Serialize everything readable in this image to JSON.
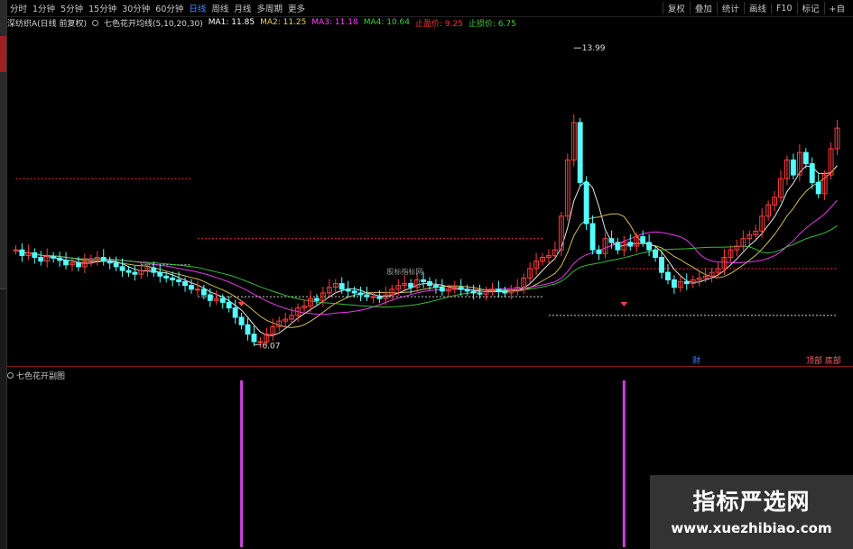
{
  "timeframes": [
    "分时",
    "1分钟",
    "5分钟",
    "15分钟",
    "30分钟",
    "60分钟",
    "日线",
    "周线",
    "月线",
    "多周期",
    "更多"
  ],
  "active_timeframe": "日线",
  "toolbar": [
    "复权",
    "叠加",
    "统计",
    "画线",
    "F10",
    "标记",
    "+自"
  ],
  "title": {
    "stock": "深纺织A(日线 前复权)",
    "indicator": "七色花开均线(5,10,20,30)",
    "ma1": "MA1: 11.85",
    "ma2": "MA2: 11.25",
    "ma3": "MA3: 11.18",
    "ma4": "MA4: 10.64",
    "stop_profit": "止盈价: 9.25",
    "stop_loss": "止损价: 6.75"
  },
  "annotations": {
    "high": "13.99",
    "low": "6.07",
    "center_watermark": "股标指标网",
    "cai_label": "财",
    "tags": "顶部 底部"
  },
  "sub_indicator": "七色花开副图",
  "watermark": {
    "cn": "指标严选网",
    "url": "www.xuezhibiao.com"
  },
  "colors": {
    "up": "#ff3c3c",
    "down": "#54ffff",
    "ma1": "#ffffff",
    "ma2": "#e8d060",
    "ma3": "#ff40ff",
    "ma4": "#40d040",
    "signal": "#d040e0",
    "stop_profit": "#ff3030",
    "stop_loss": "#d0d0d0"
  },
  "chart_data": {
    "type": "candlestick",
    "ylim": [
      5.5,
      14.5
    ],
    "closes": [
      8.6,
      8.45,
      8.52,
      8.4,
      8.3,
      8.42,
      8.38,
      8.32,
      8.2,
      8.25,
      8.15,
      8.28,
      8.35,
      8.4,
      8.3,
      8.25,
      8.15,
      8.05,
      8.0,
      7.95,
      8.05,
      8.12,
      8.0,
      7.9,
      7.85,
      7.8,
      7.75,
      7.65,
      7.55,
      7.55,
      7.4,
      7.25,
      7.3,
      7.2,
      7.05,
      6.8,
      6.6,
      6.35,
      6.15,
      6.15,
      6.35,
      6.55,
      6.7,
      6.75,
      6.85,
      7.05,
      7.1,
      7.3,
      7.25,
      7.45,
      7.6,
      7.7,
      7.55,
      7.5,
      7.45,
      7.4,
      7.35,
      7.35,
      7.3,
      7.4,
      7.55,
      7.65,
      7.7,
      7.6,
      7.8,
      7.75,
      7.65,
      7.6,
      7.5,
      7.55,
      7.6,
      7.55,
      7.5,
      7.45,
      7.42,
      7.5,
      7.55,
      7.5,
      7.45,
      7.5,
      7.6,
      7.85,
      8.1,
      8.3,
      8.4,
      8.45,
      8.6,
      9.5,
      11.0,
      12.0,
      10.4,
      9.3,
      8.6,
      8.5,
      8.9,
      8.8,
      8.6,
      8.8,
      8.7,
      8.95,
      8.8,
      8.6,
      8.4,
      8.0,
      7.8,
      7.6,
      7.75,
      7.7,
      7.8,
      7.85,
      7.9,
      8.0,
      8.1,
      8.4,
      8.6,
      8.7,
      8.9,
      9.0,
      9.1,
      9.5,
      9.8,
      10.0,
      10.5,
      11.0,
      10.6,
      11.2,
      10.9,
      10.4,
      10.1,
      10.6,
      11.3,
      11.85
    ],
    "low_point": 6.07,
    "high_point": 13.99,
    "stop_profit_levels": [
      10.5,
      8.9,
      8.1
    ],
    "stop_loss_levels": [
      8.2,
      7.35,
      6.85
    ],
    "signals": [
      {
        "index": 36,
        "label": "buy"
      },
      {
        "index": 97,
        "label": "buy"
      }
    ]
  }
}
